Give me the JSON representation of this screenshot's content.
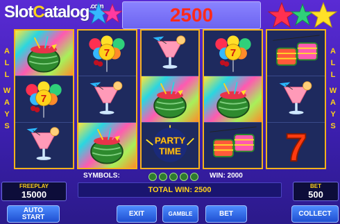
{
  "logo": {
    "slot": "Slot",
    "catalog_c": "C",
    "catalog_rest": "atalog",
    "com": ".com"
  },
  "credit": "2500",
  "side_left": [
    "A",
    "L",
    "L",
    "",
    "W",
    "A",
    "Y",
    "S"
  ],
  "side_right": [
    "A",
    "L",
    "L",
    "",
    "W",
    "A",
    "Y",
    "S"
  ],
  "reels": [
    [
      "watermelon-cocktail",
      "balloons",
      "pink-cocktail"
    ],
    [
      "balloons",
      "pink-cocktail",
      "watermelon-cocktail"
    ],
    [
      "pink-cocktail",
      "watermelon-cocktail",
      "party-time"
    ],
    [
      "balloons",
      "watermelon-cocktail",
      "maracas"
    ],
    [
      "maracas",
      "pink-cocktail",
      "seven"
    ]
  ],
  "winning_cells": [
    [
      0,
      0
    ],
    [
      1,
      2
    ],
    [
      2,
      1
    ],
    [
      3,
      1
    ]
  ],
  "party_text_1": "PARTY",
  "party_text_2": "TIME",
  "seven_text": "7",
  "info": {
    "symbols_label": "SYMBOLS:",
    "win_label": "WIN: 2000"
  },
  "total_win": "TOTAL WIN: 2500",
  "freeplay": {
    "label": "FREEPLAY",
    "value": "15000"
  },
  "bet_panel": {
    "label": "BET",
    "value": "500"
  },
  "buttons": {
    "autostart": "AUTO\nSTART",
    "exit": "EXIT",
    "gamble": "GAMBLE",
    "bet": "BET",
    "collect": "COLLECT"
  },
  "colors": {
    "reel_border": "#f7b21a",
    "credit_text": "#ff2a1a",
    "label_yellow": "#ffd21a"
  }
}
